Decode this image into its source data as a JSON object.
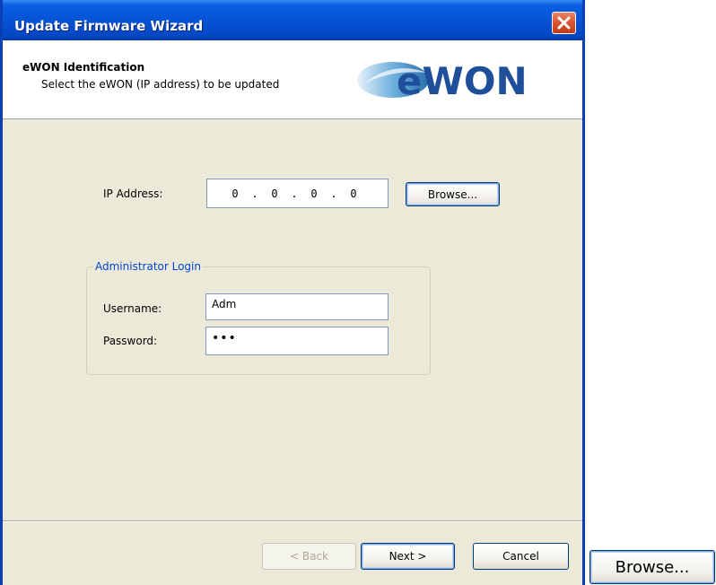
{
  "window": {
    "title": "Update Firmware Wizard"
  },
  "header": {
    "title": "eWON Identification",
    "subtitle": "Select the eWON (IP address) to be updated",
    "logo_text": "eWON"
  },
  "ip": {
    "label": "IP Address:",
    "octets": [
      "0",
      "0",
      "0",
      "0"
    ],
    "separator": ".",
    "browse_label": "Browse..."
  },
  "login": {
    "group_title": "Administrator Login",
    "username_label": "Username:",
    "username_value": "Adm",
    "password_label": "Password:",
    "password_value": "•••"
  },
  "footer": {
    "back_label": "< Back",
    "next_label": "Next >",
    "cancel_label": "Cancel"
  },
  "zoomed_button": {
    "label": "Browse..."
  },
  "colors": {
    "titlebar": "#0653d6",
    "dialog_bg": "#ece9d8",
    "group_title": "#0046d5",
    "close_button": "#d6542f"
  },
  "icons": {
    "close": "close-icon",
    "logo": "ewon-logo"
  }
}
